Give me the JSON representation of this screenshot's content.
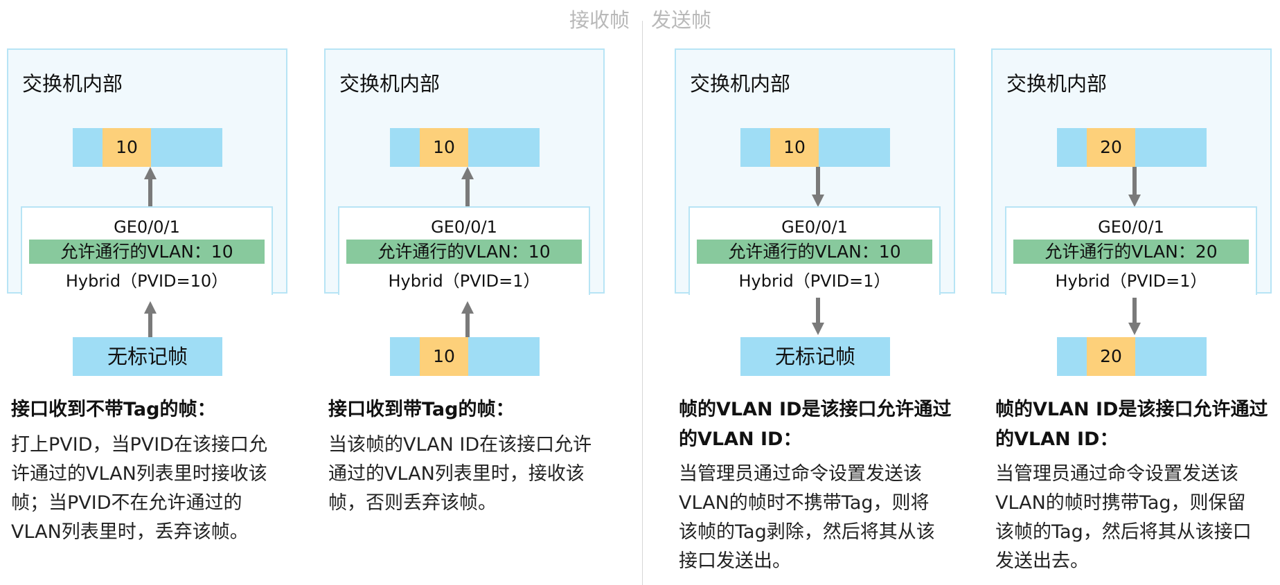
{
  "header": {
    "receive": "接收帧",
    "send": "发送帧"
  },
  "panels": [
    {
      "switch_label": "交换机内部",
      "top_frame_tag": "10",
      "port": "GE0/0/1",
      "allowed": "允许通行的VLAN：10",
      "mode": "Hybrid（PVID=10）",
      "bottom_frame_text": "无标记帧",
      "bottom_frame_tag": "",
      "title": "接口收到不带Tag的帧：",
      "body": [
        "打上PVID，当PVID在该接口允",
        "许通过的VLAN列表里时接收该",
        "帧；当PVID不在允许通过的",
        "VLAN列表里时，丢弃该帧。"
      ]
    },
    {
      "switch_label": "交换机内部",
      "top_frame_tag": "10",
      "port": "GE0/0/1",
      "allowed": "允许通行的VLAN：10",
      "mode": "Hybrid（PVID=1）",
      "bottom_frame_text": "",
      "bottom_frame_tag": "10",
      "title": "接口收到带Tag的帧：",
      "body": [
        "当该帧的VLAN ID在该接口允许",
        "通过的VLAN列表里时，接收该",
        "帧，否则丢弃该帧。"
      ]
    },
    {
      "switch_label": "交换机内部",
      "top_frame_tag": "10",
      "port": "GE0/0/1",
      "allowed": "允许通行的VLAN：10",
      "mode": "Hybrid（PVID=1）",
      "bottom_frame_text": "无标记帧",
      "bottom_frame_tag": "",
      "title_lines": [
        "帧的VLAN ID是该接口允许通过",
        "的VLAN ID："
      ],
      "body": [
        "当管理员通过命令设置发送该",
        "VLAN的帧时不携带Tag，则将",
        "该帧的Tag剥除，然后将其从该",
        "接口发送出。"
      ]
    },
    {
      "switch_label": "交换机内部",
      "top_frame_tag": "20",
      "port": "GE0/0/1",
      "allowed": "允许通行的VLAN：20",
      "mode": "Hybrid（PVID=1）",
      "bottom_frame_text": "",
      "bottom_frame_tag": "20",
      "title_lines": [
        "帧的VLAN ID是该接口允许通过",
        "的VLAN ID："
      ],
      "body": [
        "当管理员通过命令设置发送该",
        "VLAN的帧时携带Tag，则保留",
        "该帧的Tag，然后将其从该接口",
        "发送出去。"
      ]
    }
  ]
}
